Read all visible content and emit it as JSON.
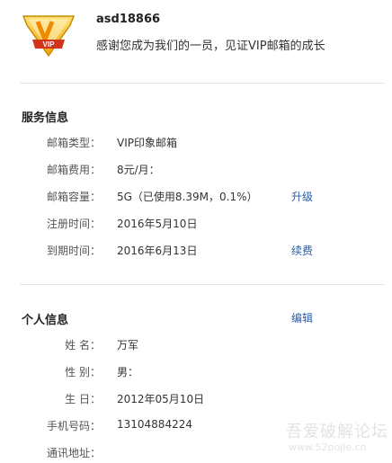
{
  "header": {
    "badge_text": "VIP",
    "username": "asd18866",
    "tagline": "感谢您成为我们的一员，见证VIP邮箱的成长"
  },
  "service": {
    "title": "服务信息",
    "rows": [
      {
        "label": "邮箱类型：",
        "value": "VIP印象邮箱",
        "action": ""
      },
      {
        "label": "邮箱费用：",
        "value": "8元/月：",
        "action": ""
      },
      {
        "label": "邮箱容量：",
        "value": "5G（已使用8.39M，0.1%）",
        "action": "升级"
      },
      {
        "label": "注册时间：",
        "value": "2016年5月10日",
        "action": ""
      },
      {
        "label": "到期时间：",
        "value": "2016年6月13日",
        "action": "续费"
      }
    ]
  },
  "personal": {
    "title": "个人信息",
    "edit_label": "编辑",
    "rows": [
      {
        "label": "姓 名：",
        "value": "万军"
      },
      {
        "label": "性 别：",
        "value": "男："
      },
      {
        "label": "生 日：",
        "value": "2012年05月10日"
      },
      {
        "label": "手机号码：",
        "value": "13104884224"
      },
      {
        "label": "通讯地址：",
        "value": ""
      }
    ]
  },
  "watermark": {
    "line1": "吾爱破解论坛",
    "line2": "www.52pojie.cn"
  },
  "colors": {
    "link": "#2a5caa",
    "badge_gold": "#f5b400",
    "badge_red": "#d0341a"
  }
}
